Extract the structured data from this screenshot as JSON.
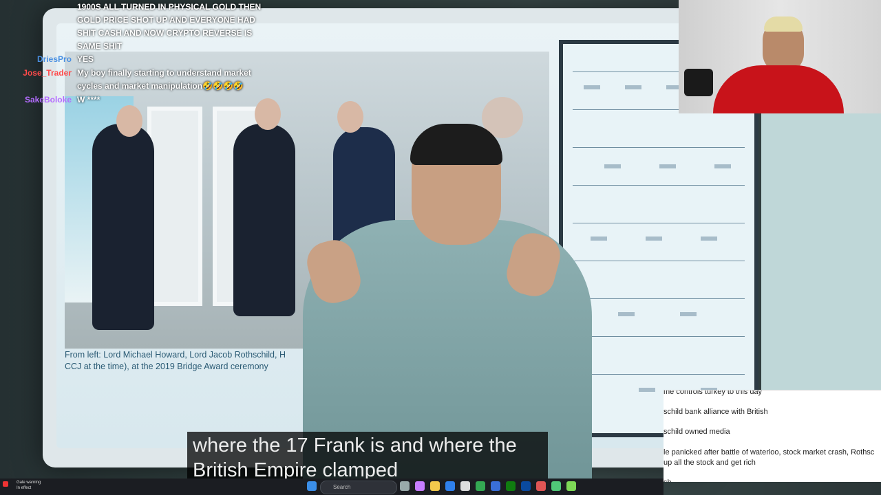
{
  "chat": {
    "messages": [
      {
        "user": "",
        "user_color": "#ffffff",
        "text": "1900S ALL TURNED IN PHYSICAL GOLD THEN"
      },
      {
        "user": "",
        "user_color": "#ffffff",
        "text": "GOLD PRICE SHOT UP AND EVERYONE HAD"
      },
      {
        "user": "",
        "user_color": "#ffffff",
        "text": "SHIT CASH AND NOW CRYPTO REVERSE IS"
      },
      {
        "user": "",
        "user_color": "#ffffff",
        "text": "SAME SHIT"
      },
      {
        "user": "DriesPro",
        "user_color": "#4a90e2",
        "text": "YES"
      },
      {
        "user": "Jose_Trader",
        "user_color": "#ff4a4a",
        "text": "My boy finally starting to understand market"
      },
      {
        "user": "",
        "user_color": "#ffffff",
        "text": "cycles and market manipulation🤣🤣🤣🤣"
      },
      {
        "user": "SakeBoloke",
        "user_color": "#b46cff",
        "text": "W ****"
      }
    ]
  },
  "photo_caption": {
    "line1": "From left: Lord Michael Howard, Lord Jacob Rothschild, H",
    "line2": "CCJ at the time), at the 2019 Bridge Award ceremony"
  },
  "subtitle": {
    "line1": "where the 17 Frank is and where the",
    "line2": "British Empire clamped"
  },
  "notes": [
    "me  controls turkey to this day",
    "schild bank alliance with British",
    "schild owned media",
    "le panicked after battle of waterloo, stock market crash, Rothsc",
    "up all the stock and get rich",
    "sh"
  ],
  "taskbar": {
    "warning_title": "Gale warning",
    "warning_sub": "In effect",
    "search_placeholder": "Search"
  }
}
